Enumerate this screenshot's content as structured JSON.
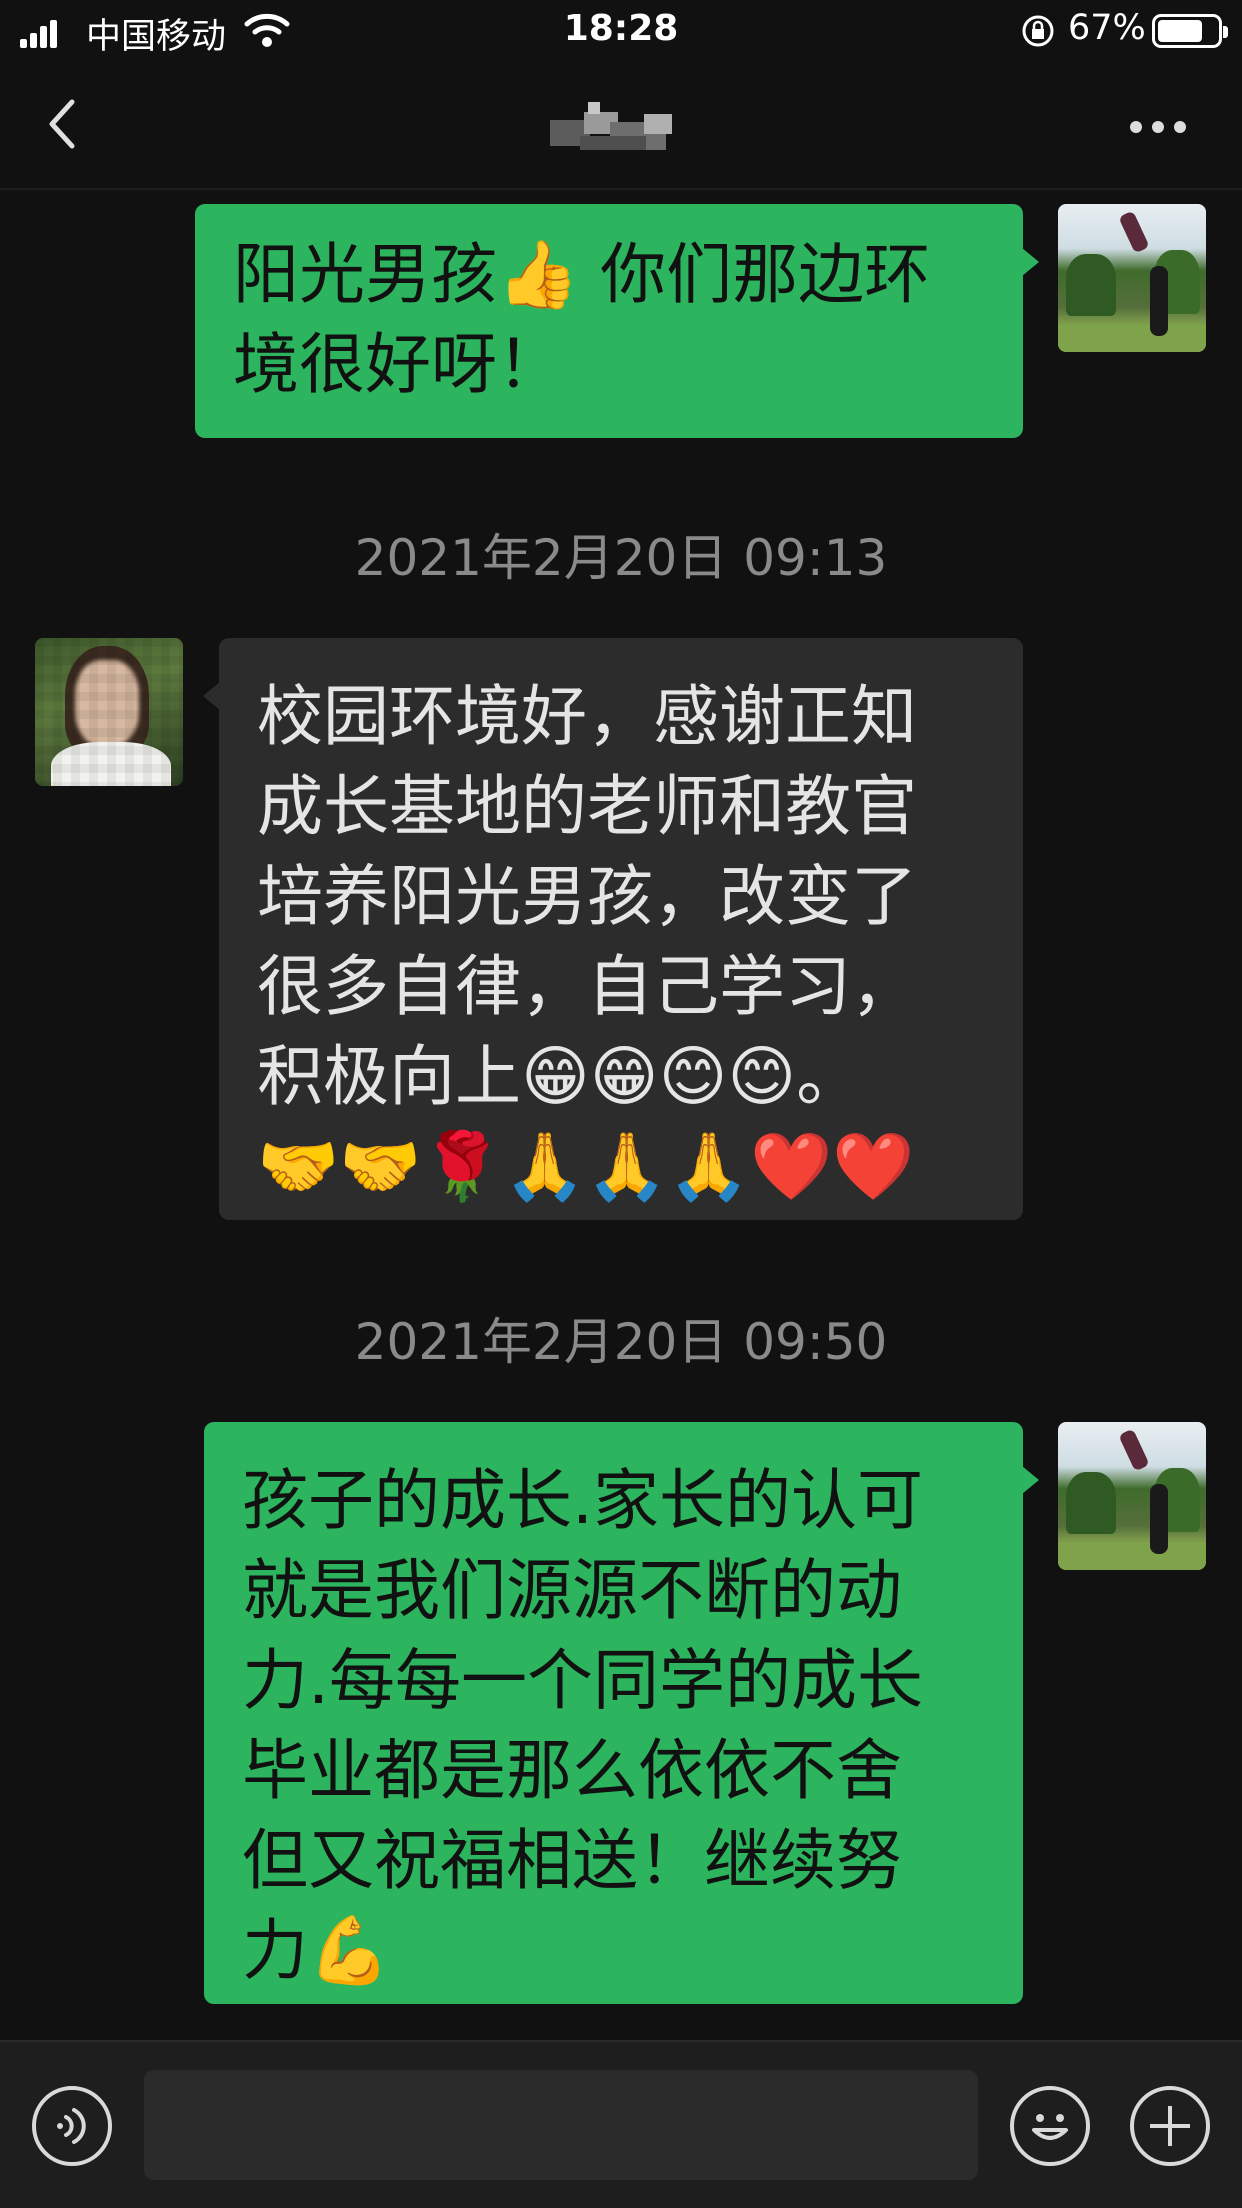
{
  "status_bar": {
    "carrier": "中国移动",
    "time": "18:28",
    "battery": "67%",
    "battery_level": 0.67
  },
  "nav": {
    "back_icon": "chevron-left-icon",
    "more_icon": "more-dots-icon"
  },
  "messages": [
    {
      "direction": "out",
      "text": "阳光男孩👍 你们那边环\n境很好呀！"
    },
    {
      "direction": "in",
      "timestamp": "2021年2月20日 09:13",
      "text": "校园环境好，感谢正知\n成长基地的老师和教官\n培养阳光男孩，改变了\n很多自律，自己学习，\n积极向上😁😁😊😊。\n🤝🤝🌹🙏🙏🙏❤️❤️"
    },
    {
      "direction": "out",
      "timestamp": "2021年2月20日 09:50",
      "text": "孩子的成长.家长的认可\n就是我们源源不断的动\n力.每每一个同学的成长\n毕业都是那么依依不舍\n但又祝福相送！继续努\n力💪"
    }
  ],
  "input_bar": {
    "voice_icon": "voice-icon",
    "emoji_icon": "emoji-icon",
    "plus_icon": "plus-icon"
  }
}
